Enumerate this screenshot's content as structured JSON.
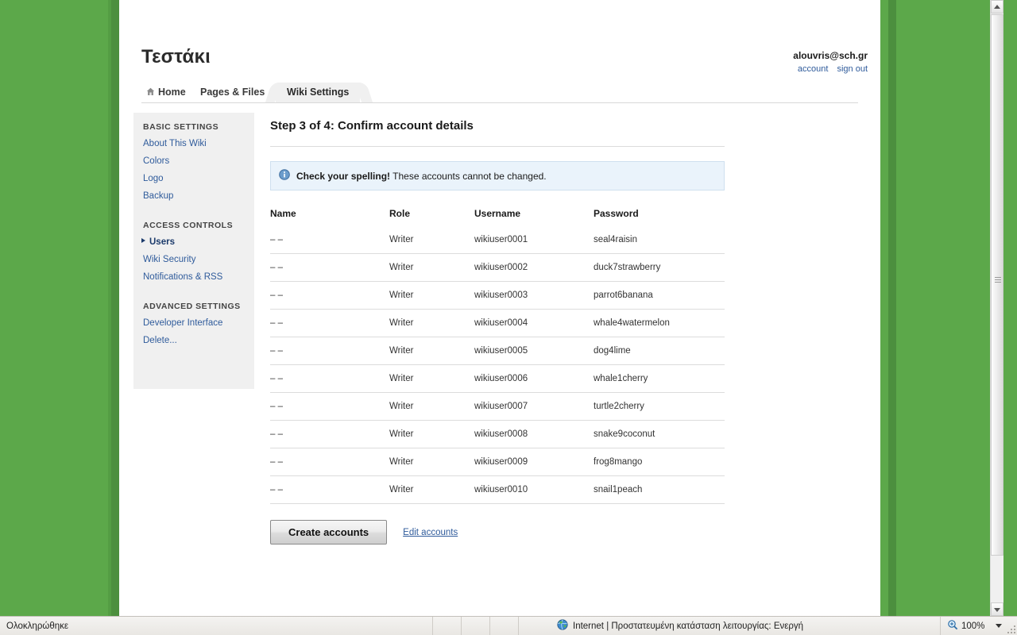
{
  "theme": {
    "background_green": "#5CA84A",
    "band_green": "#4C8F3E",
    "link_blue": "#2f5b9b",
    "info_bg": "#eaf3fb",
    "info_border": "#cfe0ef"
  },
  "header": {
    "wiki_title": "Τεστάκι",
    "account_email": "alouvris@sch.gr",
    "account_link": "account",
    "signout_link": "sign out"
  },
  "tabs": [
    {
      "label": "Home",
      "icon": "home-icon",
      "active": false
    },
    {
      "label": "Pages & Files",
      "icon": "",
      "active": false
    },
    {
      "label": "Wiki Settings",
      "icon": "",
      "active": true
    }
  ],
  "sidebar": {
    "groups": [
      {
        "title": "BASIC SETTINGS",
        "items": [
          {
            "label": "About This Wiki",
            "current": false
          },
          {
            "label": "Colors",
            "current": false
          },
          {
            "label": "Logo",
            "current": false
          },
          {
            "label": "Backup",
            "current": false
          }
        ]
      },
      {
        "title": "ACCESS CONTROLS",
        "items": [
          {
            "label": "Users",
            "current": true
          },
          {
            "label": "Wiki Security",
            "current": false
          },
          {
            "label": "Notifications & RSS",
            "current": false
          }
        ]
      },
      {
        "title": "ADVANCED SETTINGS",
        "items": [
          {
            "label": "Developer Interface",
            "current": false
          },
          {
            "label": "Delete...",
            "current": false
          }
        ]
      }
    ]
  },
  "main": {
    "heading": "Step 3 of 4: Confirm account details",
    "info_banner": {
      "icon": "info-circle-icon",
      "bold_text": "Check your spelling!",
      "text": " These accounts cannot be changed."
    },
    "table": {
      "columns": [
        "Name",
        "Role",
        "Username",
        "Password"
      ],
      "rows": [
        {
          "name": "– –",
          "role": "Writer",
          "username": "wikiuser0001",
          "password": "seal4raisin"
        },
        {
          "name": "– –",
          "role": "Writer",
          "username": "wikiuser0002",
          "password": "duck7strawberry"
        },
        {
          "name": "– –",
          "role": "Writer",
          "username": "wikiuser0003",
          "password": "parrot6banana"
        },
        {
          "name": "– –",
          "role": "Writer",
          "username": "wikiuser0004",
          "password": "whale4watermelon"
        },
        {
          "name": "– –",
          "role": "Writer",
          "username": "wikiuser0005",
          "password": "dog4lime"
        },
        {
          "name": "– –",
          "role": "Writer",
          "username": "wikiuser0006",
          "password": "whale1cherry"
        },
        {
          "name": "– –",
          "role": "Writer",
          "username": "wikiuser0007",
          "password": "turtle2cherry"
        },
        {
          "name": "– –",
          "role": "Writer",
          "username": "wikiuser0008",
          "password": "snake9coconut"
        },
        {
          "name": "– –",
          "role": "Writer",
          "username": "wikiuser0009",
          "password": "frog8mango"
        },
        {
          "name": "– –",
          "role": "Writer",
          "username": "wikiuser0010",
          "password": "snail1peach"
        }
      ]
    },
    "actions": {
      "create_button": "Create accounts",
      "edit_link": "Edit accounts"
    }
  },
  "status_bar": {
    "left_text": "Ολοκληρώθηκε",
    "zone_icon": "globe-icon",
    "zone_text": "Internet | Προστατευμένη κατάσταση λειτουργίας: Ενεργή",
    "zoom_icon": "zoom-in-icon",
    "zoom_level": "100%"
  }
}
